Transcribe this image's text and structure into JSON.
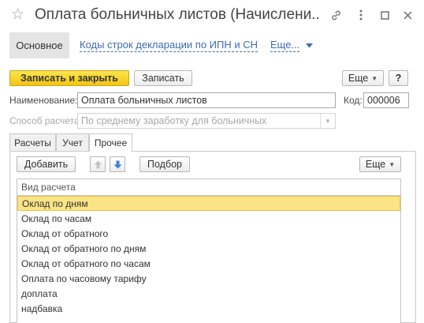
{
  "window": {
    "title": "Оплата больничных листов (Начислени...",
    "star_icon": "☆",
    "link_icon": "🔗",
    "more_icon": "⋮",
    "maximize_icon": "☐",
    "close_icon": "✕"
  },
  "nav": {
    "main": "Основное",
    "codes_link": "Коды строк декларации по ИПН и СН",
    "more_link": "Еще..."
  },
  "toolbar": {
    "save_close": "Записать и закрыть",
    "save": "Записать",
    "more": "Еще",
    "help": "?"
  },
  "form": {
    "name_label": "Наименование:",
    "name_value": "Оплата больничных листов",
    "code_label": "Код:",
    "code_value": "000006",
    "method_label": "Способ расчета:",
    "method_value": "По среднему заработку для больничных"
  },
  "tabs": [
    {
      "label": "Расчеты"
    },
    {
      "label": "Учет"
    },
    {
      "label": "Прочее"
    }
  ],
  "list_toolbar": {
    "add": "Добавить",
    "pick": "Подбор",
    "more": "Еще"
  },
  "table": {
    "header": "Вид расчета",
    "rows": [
      "Оклад по дням",
      "Оклад по часам",
      "Оклад от обратного",
      "Оклад от обратного по дням",
      "Оклад от обратного по часам",
      "Оплата по часовому тарифу",
      "доплата",
      "надбавка"
    ]
  },
  "colors": {
    "accent_yellow": "#f2c413",
    "link_blue": "#3c6bb5",
    "selection": "#fbe486"
  }
}
